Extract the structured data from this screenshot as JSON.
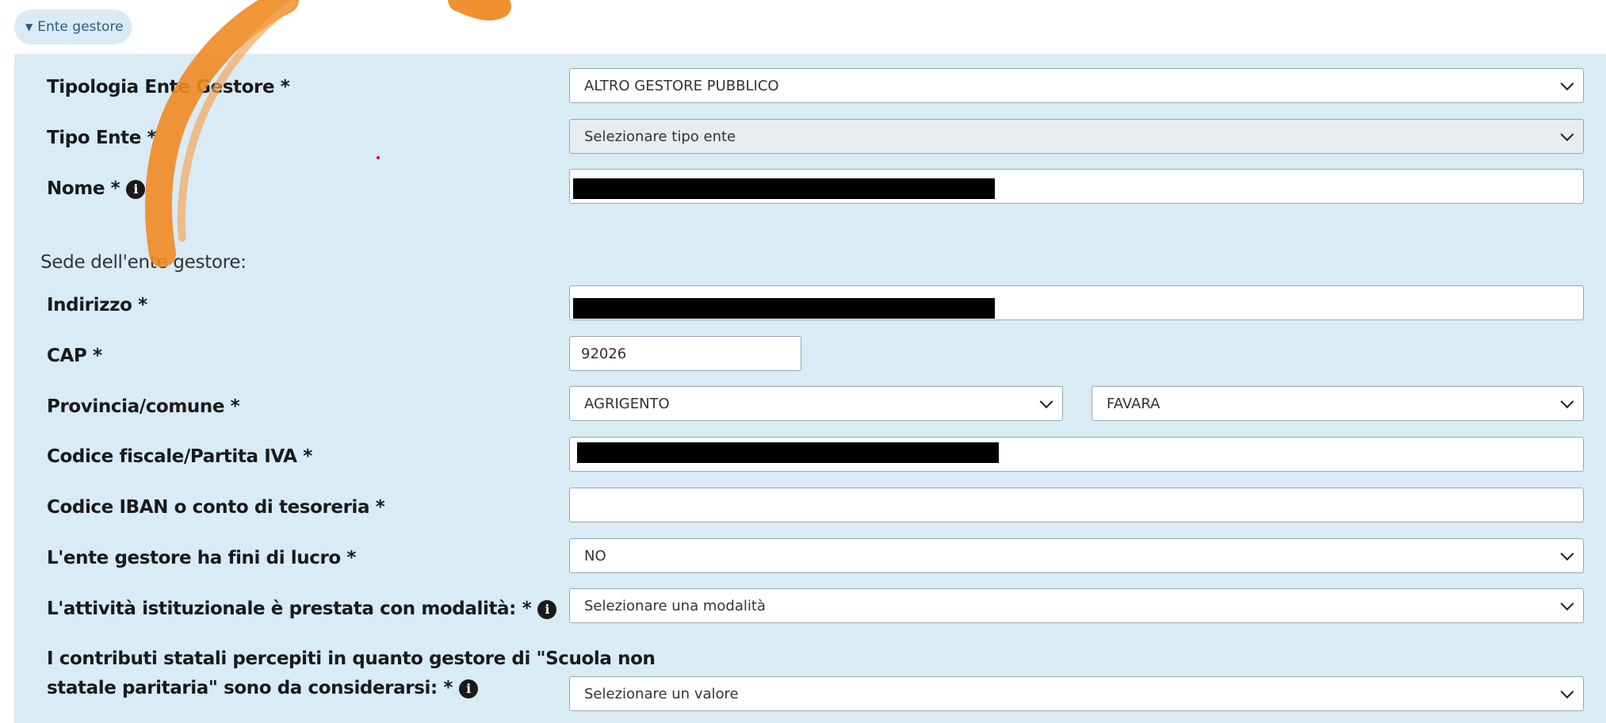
{
  "section_toggle": {
    "label": "Ente gestore",
    "icon": "caret-down-icon"
  },
  "rows": {
    "tipologia": {
      "label": "Tipologia Ente Gestore *",
      "value": "ALTRO GESTORE PUBBLICO"
    },
    "tipo_ente": {
      "label": "Tipo Ente *",
      "placeholder": "Selezionare tipo ente"
    },
    "nome": {
      "label": "Nome *",
      "value": "[redacted]"
    },
    "sede_title": "Sede dell'ente gestore:",
    "indirizzo": {
      "label": "Indirizzo *",
      "value": "[redacted]"
    },
    "cap": {
      "label": "CAP *",
      "value": "92026"
    },
    "provincia_comune": {
      "label": "Provincia/comune *",
      "provincia": "AGRIGENTO",
      "comune": "FAVARA"
    },
    "codice_fiscale": {
      "label": "Codice fiscale/Partita IVA *",
      "value": "[redacted]"
    },
    "iban": {
      "label": "Codice IBAN o conto di tesoreria *",
      "value": ""
    },
    "fini_lucro": {
      "label": "L'ente gestore ha fini di lucro *",
      "value": "NO"
    },
    "modalita": {
      "label": "L'attività istituzionale è prestata con modalità:  *",
      "placeholder": "Selezionare una modalità"
    },
    "contributi": {
      "label_line1": "I contributi statali percepiti in quanto gestore di \"Scuola non",
      "label_line2": "statale paritaria\" sono da considerarsi:  *",
      "placeholder": "Selezionare un valore"
    }
  },
  "colors": {
    "panel_bg": "#d9ebf5",
    "pill_text": "#2a5d80",
    "brush": "#f08a24"
  }
}
